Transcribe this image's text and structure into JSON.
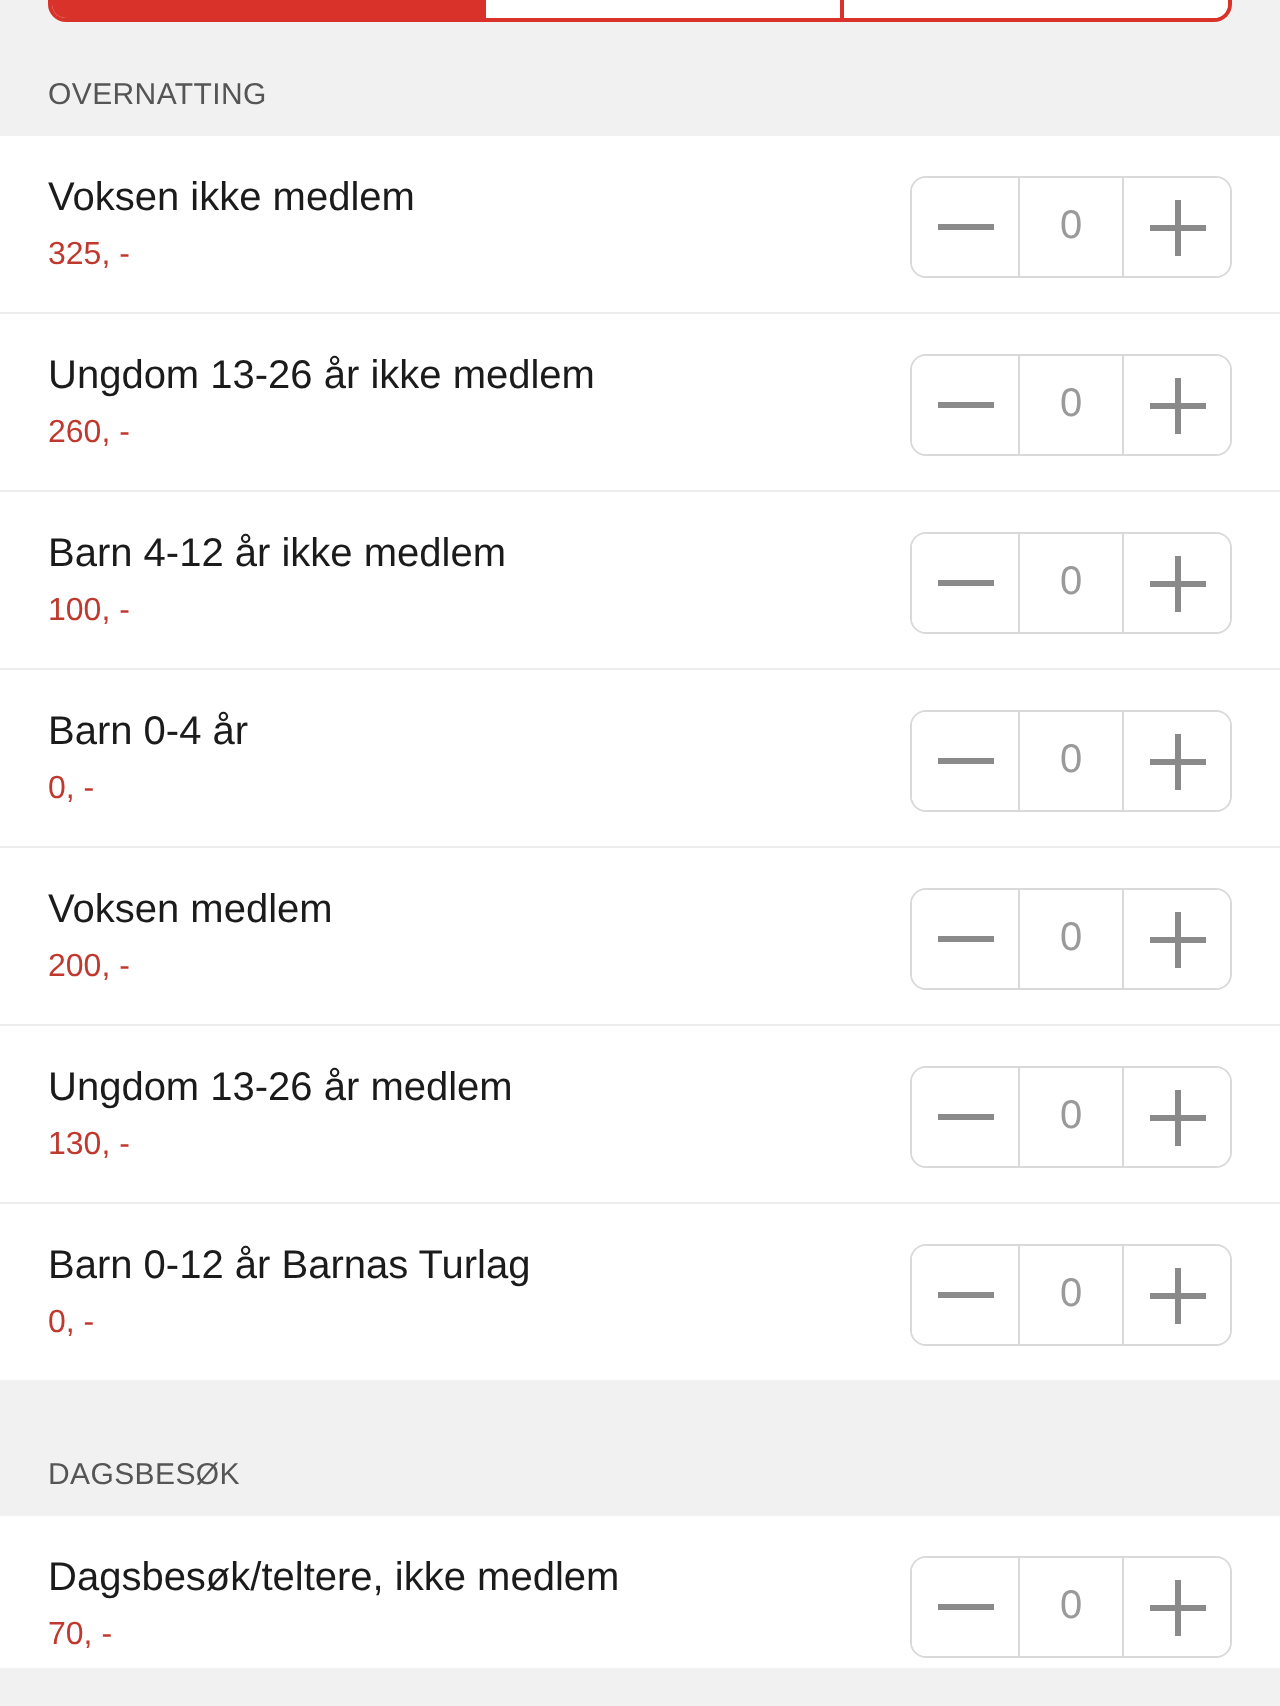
{
  "segments": [
    {
      "selected": true
    },
    {
      "selected": false
    },
    {
      "selected": false
    }
  ],
  "sections": [
    {
      "title": "OVERNATTING",
      "items": [
        {
          "name": "Voksen ikke medlem",
          "price": "325, -",
          "count": "0"
        },
        {
          "name": "Ungdom 13-26 år ikke medlem",
          "price": "260, -",
          "count": "0"
        },
        {
          "name": "Barn 4-12 år ikke medlem",
          "price": "100, -",
          "count": "0"
        },
        {
          "name": "Barn 0-4 år",
          "price": "0, -",
          "count": "0"
        },
        {
          "name": "Voksen medlem",
          "price": "200, -",
          "count": "0"
        },
        {
          "name": "Ungdom 13-26 år medlem",
          "price": "130, -",
          "count": "0"
        },
        {
          "name": "Barn 0-12 år Barnas Turlag",
          "price": "0, -",
          "count": "0"
        }
      ]
    },
    {
      "title": "DAGSBESØK",
      "items": [
        {
          "name": "Dagsbesøk/teltere, ikke medlem",
          "price": "70, -",
          "count": "0"
        }
      ]
    }
  ]
}
